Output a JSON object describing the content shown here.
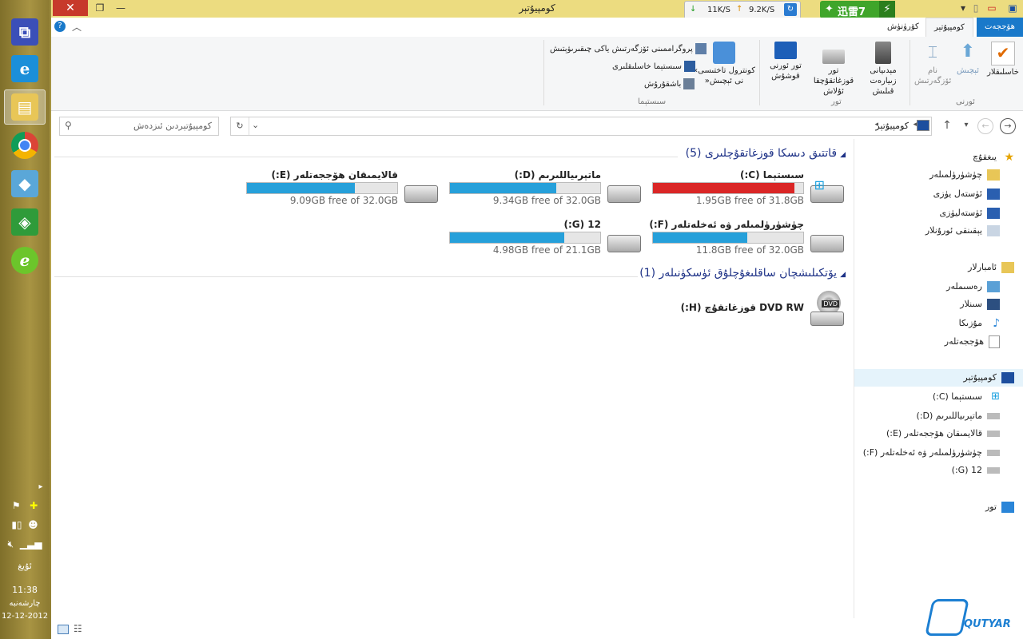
{
  "window": {
    "title": "كومپيۇتېر"
  },
  "netmon": {
    "down": "11K/S",
    "up": "9.2K/S"
  },
  "xunlei": {
    "label": "迅雷7"
  },
  "ribbon_tabs": {
    "file": "ھۆججەت",
    "computer": "كومپيۇتېر",
    "view": "كۆرۈنۈش"
  },
  "ribbon": {
    "properties": "خاسلىقلار",
    "open": "ئېچىش",
    "rename_l1": "نام",
    "rename_l2": "ئۆزگەرتىش",
    "media_l1": "مېدىيانى زىيارەت",
    "media_l2": "قىلىش",
    "map_l1": "تور قوزغاتقۇچقا",
    "map_l2": "ئۇلاش",
    "netloc_l1": "تور ئورنى",
    "netloc_l2": "قوشۇش",
    "control_l1": "«كونترول تاختىسى",
    "control_l2": "»نى ئېچىش",
    "uninstall": "پروگراممىنى ئۆزگەرتىش ياكى چىقىرىۋېتىش",
    "sysprops": "سىستېما خاسلىقلىرى",
    "manage": "باشقۇرۇش",
    "group_location": "ئورنى",
    "group_network": "تور",
    "group_system": "سىستېما"
  },
  "search": {
    "placeholder": "كومپيۇتېردىن ئىزدەش"
  },
  "address": {
    "crumb": "كومپيۇتېر"
  },
  "content": {
    "hdd_header": "قاتتىق دىسكا قوزغاتقۇچلىرى (5)",
    "removable_header": "يۆتكىلىشچان ساقلىغۇچلۇق ئۈسكۈنىلەر (1)",
    "drives": [
      {
        "name": "سىستېما (C:)",
        "free": "1.95GB free of 31.8GB",
        "used_fraction": 0.94
      },
      {
        "name": "ماتېرىياللىرىم (D:)",
        "free": "9.34GB free of 32.0GB",
        "used_fraction": 0.71
      },
      {
        "name": "قالايمىقان ھۆججەتلەر (E:)",
        "free": "9.09GB free of 32.0GB",
        "used_fraction": 0.72
      },
      {
        "name": "چۈشۈرۈلمىلەر ۋە ئەخلەتلەر (F:)",
        "free": "11.8GB free of 32.0GB",
        "used_fraction": 0.63
      },
      {
        "name": "12 (G:)",
        "free": "4.98GB free of 21.1GB",
        "used_fraction": 0.76
      }
    ],
    "dvd": {
      "name": "DVD RW قوزغاتقۇچ (H:)",
      "badge": "DVD"
    }
  },
  "navpane": {
    "favorites": "يىغقۇچ",
    "downloads": "چۈشۈرۈلمىلەر",
    "desktop": "ئۈستەل يۈزى",
    "desktop2": "ئۈستەليۈزى",
    "recent": "يېقىنقى ئورۇنلار",
    "libraries": "ئامبارلار",
    "pictures": "رەسىملەر",
    "videos": "سىنلار",
    "music": "مۇزىكا",
    "documents": "ھۆججەتلەر",
    "computer": "كومپيۇتېر",
    "drive_c": "سىستېما (C:)",
    "drive_d": "ماتېرىياللىرىم (D:)",
    "drive_e": "قالايمىقان ھۆججەتلەر (E:)",
    "drive_f": "چۈشۈرۈلمىلەر ۋە ئەخلەتلەر (F:)",
    "drive_g": "12 (G:)",
    "network": "تور"
  },
  "tray": {
    "lang": "ئۇيغ",
    "time": "11:38",
    "day": "چارشەنبە",
    "date": "12-12-2012"
  },
  "logo": {
    "text": "QUTYAR"
  },
  "colors": {
    "accent": "#1979ca",
    "bar_normal": "#26a0da",
    "bar_full": "#da2626",
    "title_bar": "#ecdc80"
  }
}
